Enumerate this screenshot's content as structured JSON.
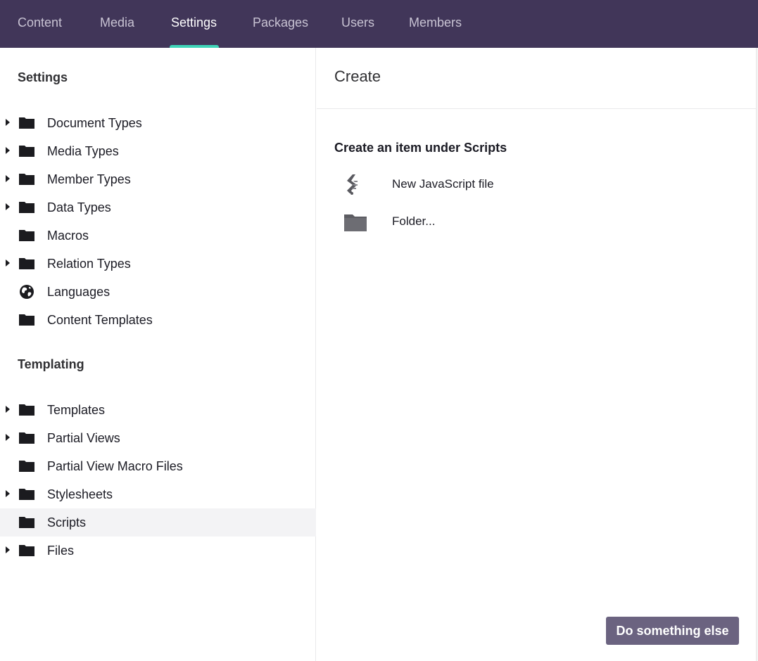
{
  "nav": {
    "tabs": [
      {
        "label": "Content",
        "active": false
      },
      {
        "label": "Media",
        "active": false
      },
      {
        "label": "Settings",
        "active": true
      },
      {
        "label": "Packages",
        "active": false
      },
      {
        "label": "Users",
        "active": false
      },
      {
        "label": "Members",
        "active": false
      }
    ],
    "colors": {
      "background": "#413659",
      "active_underline": "#3fd5b8"
    }
  },
  "sidebar": {
    "settings_title": "Settings",
    "settings_items": [
      {
        "label": "Document Types",
        "icon": "folder-icon",
        "expandable": true
      },
      {
        "label": "Media Types",
        "icon": "folder-icon",
        "expandable": true
      },
      {
        "label": "Member Types",
        "icon": "folder-icon",
        "expandable": true
      },
      {
        "label": "Data Types",
        "icon": "folder-icon",
        "expandable": true
      },
      {
        "label": "Macros",
        "icon": "folder-icon",
        "expandable": false
      },
      {
        "label": "Relation Types",
        "icon": "folder-icon",
        "expandable": true
      },
      {
        "label": "Languages",
        "icon": "globe-icon",
        "expandable": false
      },
      {
        "label": "Content Templates",
        "icon": "folder-icon",
        "expandable": false
      }
    ],
    "templating_title": "Templating",
    "templating_items": [
      {
        "label": "Templates",
        "icon": "folder-icon",
        "expandable": true
      },
      {
        "label": "Partial Views",
        "icon": "folder-icon",
        "expandable": true
      },
      {
        "label": "Partial View Macro Files",
        "icon": "folder-icon",
        "expandable": false
      },
      {
        "label": "Stylesheets",
        "icon": "folder-icon",
        "expandable": true
      },
      {
        "label": "Scripts",
        "icon": "folder-icon",
        "expandable": false,
        "selected": true
      },
      {
        "label": "Files",
        "icon": "folder-icon",
        "expandable": true
      }
    ]
  },
  "panel": {
    "title": "Create",
    "heading": "Create an item under Scripts",
    "options": [
      {
        "label": "New JavaScript file",
        "icon": "javascript-file-icon"
      },
      {
        "label": "Folder...",
        "icon": "folder-icon"
      }
    ],
    "action_button": "Do something else",
    "action_button_color": "#6b6380"
  }
}
